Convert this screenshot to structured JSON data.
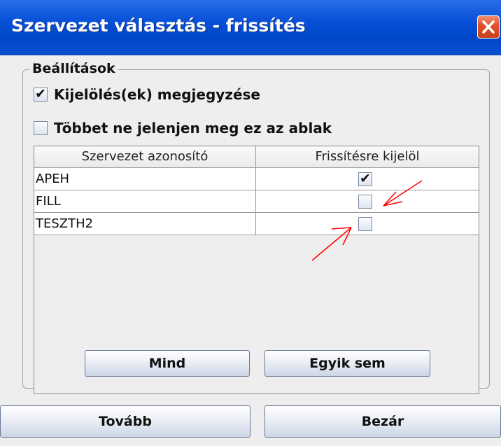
{
  "window": {
    "title": "Szervezet választás - frissítés",
    "accent_color": "#0a52d8",
    "close_icon": "close-icon"
  },
  "settings": {
    "legend": "Beállítások",
    "remember_label": "Kijelölés(ek) megjegyzése",
    "remember_checked": true,
    "hide_label": "Többet ne jelenjen meg ez az ablak",
    "hide_checked": false
  },
  "table": {
    "columns": [
      "Szervezet azonosító",
      "Frissítésre kijelöl"
    ],
    "rows": [
      {
        "id": "APEH",
        "selected": true
      },
      {
        "id": "FILL",
        "selected": false
      },
      {
        "id": "TESZTH2",
        "selected": false
      }
    ]
  },
  "buttons": {
    "all_label": "Mind",
    "none_label": "Egyik sem",
    "next_label": "Tovább",
    "close_label": "Bezár"
  },
  "annotation_color": "#ff0000"
}
